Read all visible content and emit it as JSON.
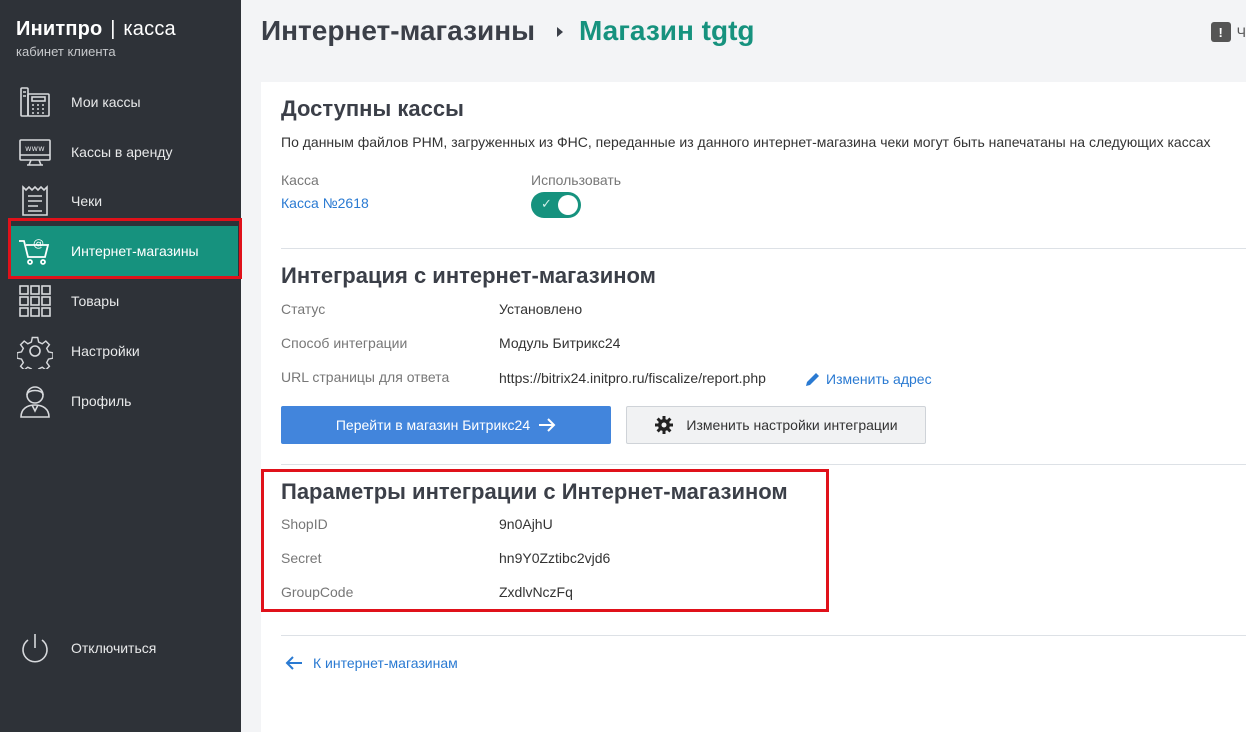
{
  "sidebar": {
    "brand": {
      "name": "Инитпро",
      "separator": "|",
      "product": "касса",
      "subtitle": "кабинет клиента"
    },
    "items": [
      {
        "label": "Мои кассы",
        "icon": "cash-register-icon"
      },
      {
        "label": "Кассы в аренду",
        "icon": "www-monitor-icon"
      },
      {
        "label": "Чеки",
        "icon": "receipt-icon"
      },
      {
        "label": "Интернет-магазины",
        "icon": "shopping-cart-icon",
        "active": true
      },
      {
        "label": "Товары",
        "icon": "grid-icon"
      },
      {
        "label": "Настройки",
        "icon": "gear-icon"
      },
      {
        "label": "Профиль",
        "icon": "user-icon"
      }
    ],
    "logout": {
      "label": "Отключиться",
      "icon": "power-icon"
    }
  },
  "header": {
    "parent": "Интернет-магазины",
    "current": "Магазин tgtg",
    "feedback_label": "Ч"
  },
  "registers": {
    "title": "Доступны кассы",
    "description": "По данным файлов РНМ, загруженных из ФНС, переданные из данного интернет-магазина чеки могут быть напечатаны на следующих кассах",
    "col_register": "Касса",
    "col_use": "Использовать",
    "register_name": "Касса №2618",
    "use_enabled": true
  },
  "integration": {
    "title": "Интеграция с интернет-магазином",
    "status_label": "Статус",
    "status_value": "Установлено",
    "method_label": "Способ интеграции",
    "method_value": "Модуль Битрикс24",
    "url_label": "URL страницы для ответа",
    "url_value": "https://bitrix24.initpro.ru/fiscalize/report.php",
    "change_address": "Изменить адрес",
    "go_button": "Перейти в магазин Битрикс24",
    "settings_button": "Изменить настройки интеграции"
  },
  "params": {
    "title": "Параметры интеграции с Интернет-магазином",
    "shopid_label": "ShopID",
    "shopid_value": "9n0AjhU",
    "secret_label": "Secret",
    "secret_value": "hn9Y0Zztibc2vjd6",
    "groupcode_label": "GroupCode",
    "groupcode_value": "ZxdlvNczFq"
  },
  "back_link": "К интернет-магазинам",
  "colors": {
    "accent": "#16927e",
    "sidebar_bg": "#2e3238",
    "primary_button": "#4285dc",
    "highlight": "#e0111a"
  }
}
